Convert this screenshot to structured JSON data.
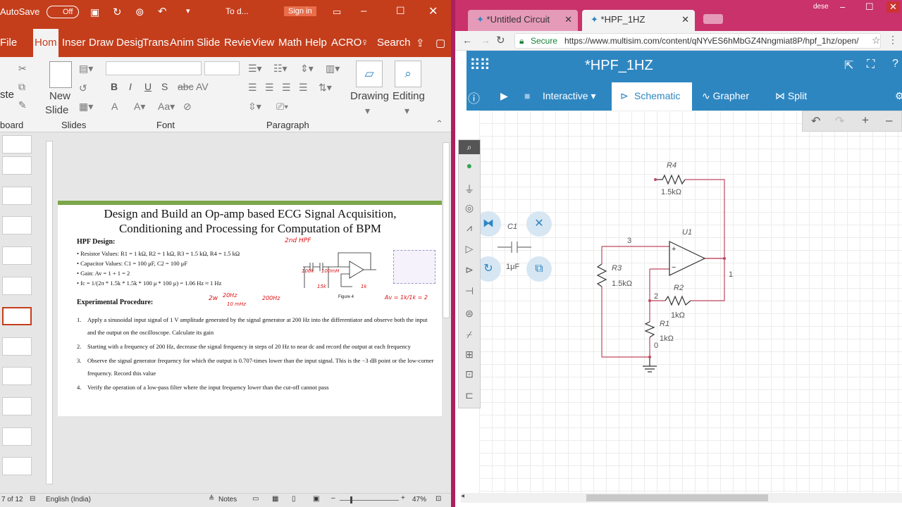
{
  "ppt": {
    "titlebar": {
      "autosave": "AutoSave",
      "autosave_state": "Off",
      "doc_title": "To d...",
      "sign_in": "Sign in"
    },
    "tabs": [
      "File",
      "Hom",
      "Inser",
      "Draw",
      "Desig",
      "Trans",
      "Anim",
      "Slide",
      "Revie",
      "View",
      "Math",
      "Help",
      "ACRO"
    ],
    "search": "Search",
    "ribbon": {
      "new_slide_1": "New",
      "new_slide_2": "Slide",
      "drawing": "Drawing",
      "editing": "Editing",
      "groups": {
        "clipboard": "board",
        "slides": "Slides",
        "font": "Font",
        "paragraph": "Paragraph"
      },
      "paste_text": "ste"
    },
    "slide": {
      "title_line1": "Design and Build an Op-amp based ECG Signal Acquisition,",
      "title_line2": "Conditioning and Processing for Computation of BPM",
      "hpf_heading": "HPF Design:",
      "bullets": [
        "Resistor Values: R1 = 1 kΩ, R2 = 1 kΩ, R3 = 1.5 kΩ, R4 = 1.5 kΩ",
        "Capacitor Values: C1 = 100 μF, C2 = 100 μF",
        "Gain: Av = 1 + 1 = 2",
        "fc = 1/(2π * 1.5k * 1.5k * 100 μ * 100 μ) = 1.06 Hz ≈ 1 Hz"
      ],
      "experimental_heading": "Experimental Procedure:",
      "steps": [
        {
          "num": "1.",
          "text": "Apply a sinusoidal input signal of 1 V amplitude generated by the signal generator at 200 Hz into the differentiator and observe both the input and the output on the oscilloscope. Calculate its gain"
        },
        {
          "num": "2.",
          "text": "Starting with a frequency of 200 Hz, decrease the signal frequency in steps of 20 Hz to near dc and record the output at each frequency"
        },
        {
          "num": "3.",
          "text": "Observe the signal generator frequency for which the output is 0.707-times lower than the input signal. This is the −3 dB point or the low-corner frequency. Record this value"
        },
        {
          "num": "4.",
          "text": "Verify the operation of a low-pass filter where the input frequency lower than the cut-off cannot pass"
        }
      ],
      "figure_label": "Figure 4",
      "annotations": {
        "a1": "2nd HPF",
        "a2": "100k",
        "a3": "100mH",
        "a4": "15k",
        "a5": "2w",
        "a6": "20Hz",
        "a7": "10 mHz",
        "a8": "200Hz",
        "a9": "Av = 1k/1k = 2",
        "a10": "1k"
      }
    },
    "status": {
      "slide_of": "7 of 12",
      "language": "English (India)",
      "notes": "Notes",
      "zoom": "47%"
    }
  },
  "chrome": {
    "tabs": [
      {
        "title": "*Untitled Circuit"
      },
      {
        "title": "*HPF_1HZ"
      }
    ],
    "window_user": "dese",
    "secure": "Secure",
    "url": "https://www.multisim.com/content/qNYvES6hMbGZ4Nngmiat8P/hpf_1hz/open/"
  },
  "multisim": {
    "title": "*HPF_1HZ",
    "toolbar": {
      "mode": "Interactive",
      "schematic": "Schematic",
      "grapher": "Grapher",
      "split": "Split"
    },
    "components": {
      "R4": {
        "name": "R4",
        "value": "1.5kΩ"
      },
      "R3": {
        "name": "R3",
        "value": "1.5kΩ"
      },
      "R2": {
        "name": "R2",
        "value": "1kΩ"
      },
      "R1": {
        "name": "R1",
        "value": "1kΩ"
      },
      "C1": {
        "name": "C1",
        "value": "1μF"
      },
      "U1": {
        "name": "U1"
      }
    },
    "nodes": {
      "n3": "3",
      "n2": "2",
      "n1": "1",
      "n0": "0"
    }
  }
}
